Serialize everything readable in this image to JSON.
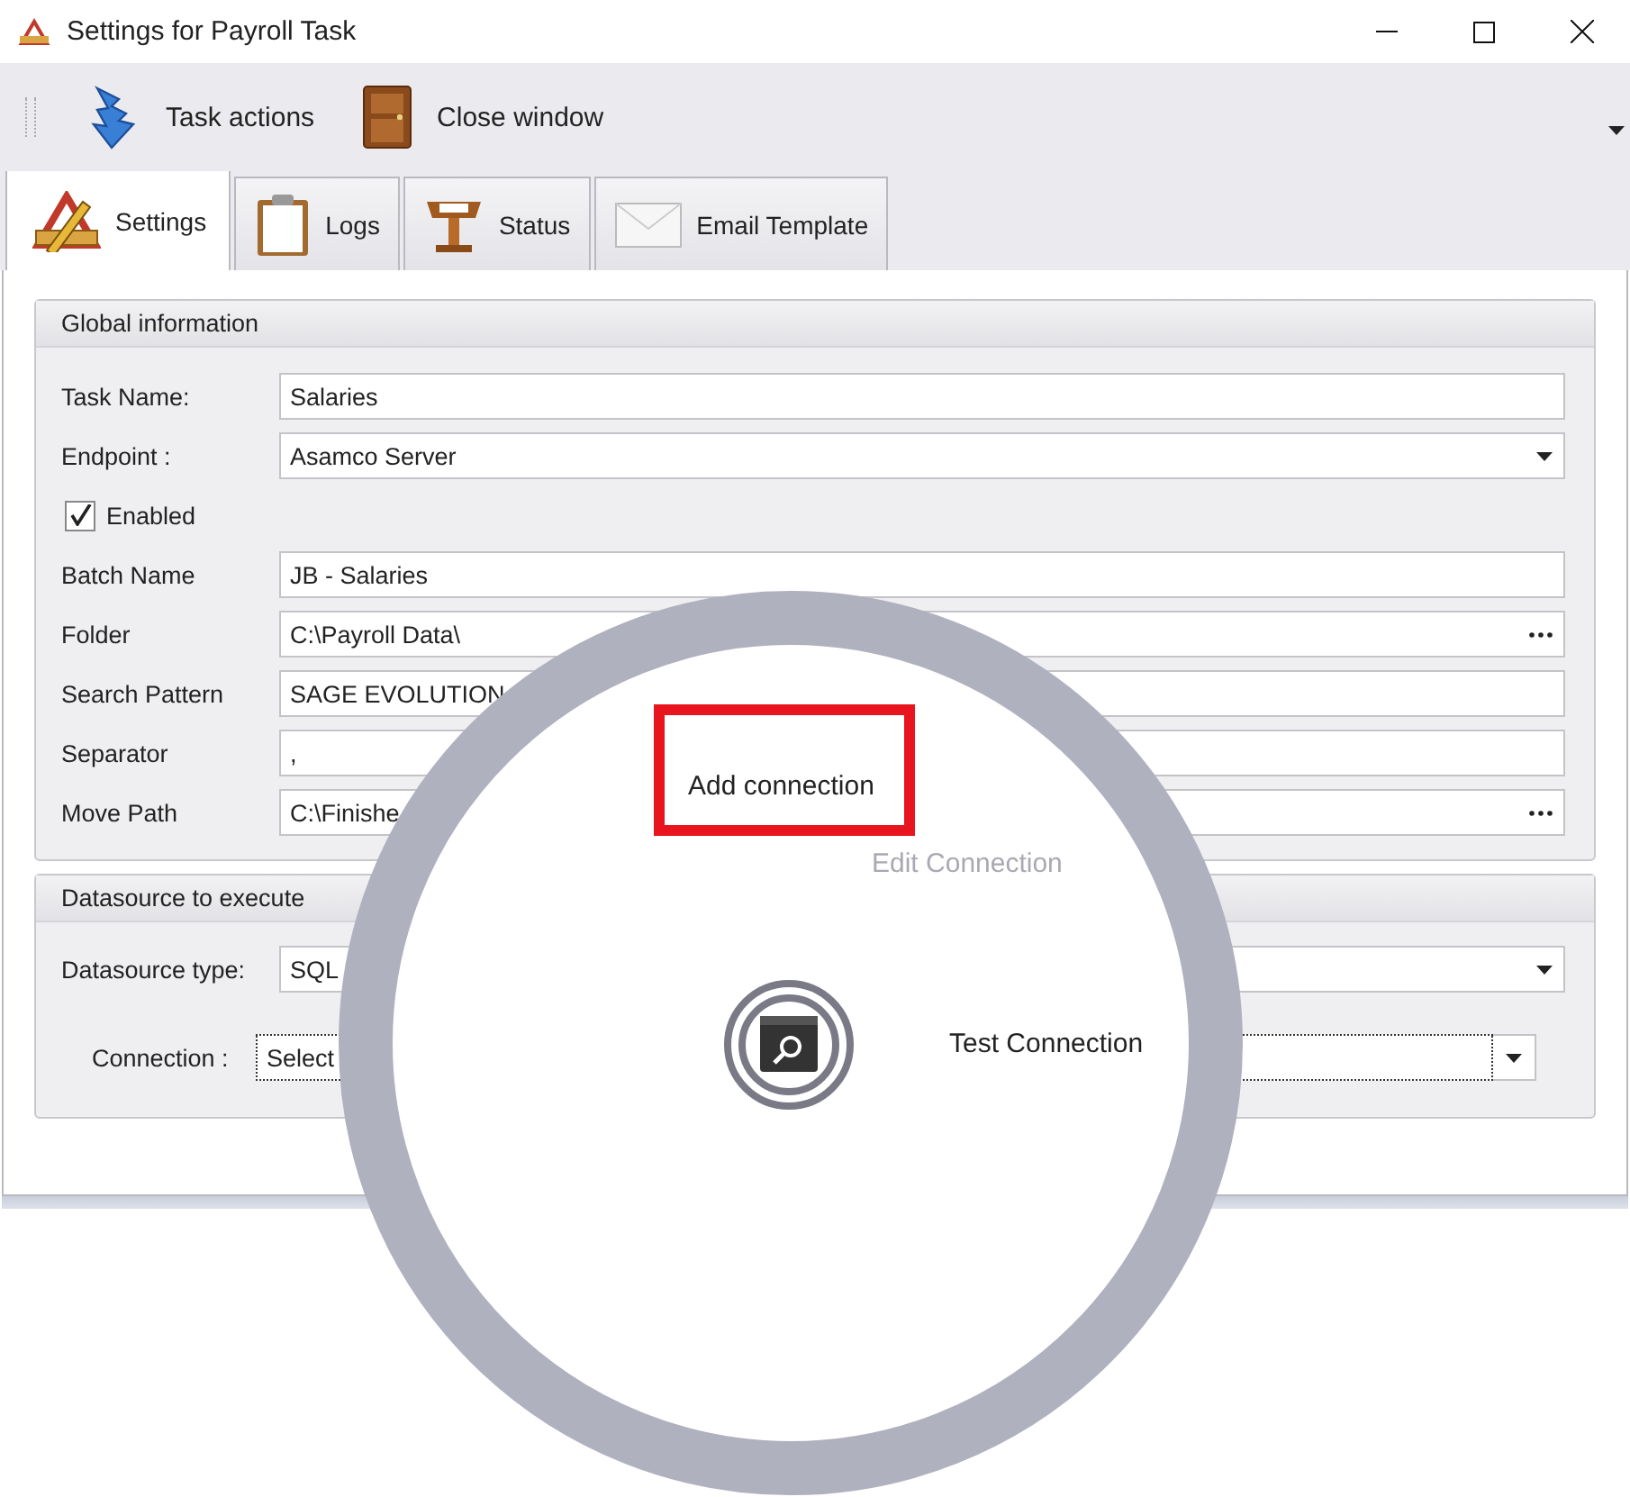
{
  "window": {
    "title": "Settings for Payroll Task"
  },
  "toolbar": {
    "items": [
      {
        "label": "Task actions",
        "kind": "arrow"
      },
      {
        "label": "Close window",
        "kind": "door"
      }
    ]
  },
  "tabs": [
    {
      "label": "Settings",
      "selected": true,
      "kind": "tools"
    },
    {
      "label": "Logs",
      "selected": false,
      "kind": "clipboard"
    },
    {
      "label": "Status",
      "selected": false,
      "kind": "lectern"
    },
    {
      "label": "Email Template",
      "selected": false,
      "kind": "envelope"
    }
  ],
  "global_information": {
    "title": "Global information",
    "fields": [
      {
        "label": "Task Name:",
        "kind": "text",
        "value": "Salaries"
      },
      {
        "label": "Endpoint :",
        "kind": "dropdown",
        "value": "Asamco Server"
      },
      {
        "label": "Enabled",
        "kind": "checkbox",
        "checked": true
      },
      {
        "label": "Batch Name",
        "kind": "text",
        "value": "JB - Salaries"
      },
      {
        "label": "Folder",
        "kind": "browse",
        "value": "C:\\Payroll Data\\"
      },
      {
        "label": "Search Pattern",
        "kind": "text",
        "value": "SAGE EVOLUTION"
      },
      {
        "label": "Separator",
        "kind": "text",
        "value": ","
      },
      {
        "label": "Move Path",
        "kind": "browse",
        "value": "C:\\Finishe"
      }
    ]
  },
  "datasource": {
    "title": "Datasource to execute",
    "fields": [
      {
        "label": "Datasource type:",
        "kind": "dropdown",
        "value": "SQL"
      },
      {
        "label": "Connection :",
        "kind": "focused_dropdown",
        "value": "Select"
      }
    ]
  },
  "radial_menu": {
    "items": [
      {
        "label": "Add connection",
        "highlighted": true,
        "disabled": false
      },
      {
        "label": "Edit Connection",
        "highlighted": false,
        "disabled": true
      },
      {
        "label": "Test Connection",
        "highlighted": false,
        "disabled": false
      }
    ]
  }
}
